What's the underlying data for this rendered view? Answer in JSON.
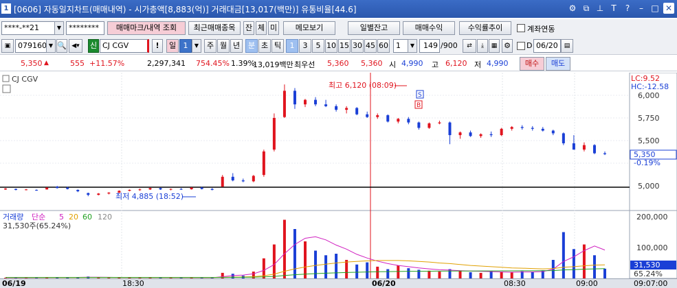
{
  "window": {
    "number": "1",
    "title": "[0606] 자동일지차트(매매내역) - 시가총액[8,883(억)] 거래대금[13,017(백만)] 유통비율[44.6]",
    "icons": [
      "settings-icon",
      "restore-icon",
      "pin-icon",
      "font-icon",
      "help-icon",
      "minimize-icon",
      "maximize-icon",
      "close-icon"
    ],
    "icon_glyphs": [
      "⚙",
      "⧉",
      "⊥",
      "T",
      "?",
      "–",
      "□",
      "✕"
    ]
  },
  "toolbar1": {
    "account": "****-**21",
    "password": "********",
    "trade_mark_btn": "매매마크/내역 조회",
    "recent_btn": "최근매매종목",
    "jan_btn": "잔",
    "che_btn": "체",
    "mi_btn": "미",
    "memo_btn": "메모보기",
    "daily_btn": "일별잔고",
    "profit_btn": "매매수익",
    "yield_btn": "수익률추이",
    "account_link_label": "계좌연동"
  },
  "toolbar2": {
    "code": "079160",
    "shin": "신",
    "stock_name": "CJ CGV",
    "excl": "!",
    "il": "일",
    "il_num": "1",
    "periods": [
      "주",
      "월",
      "년",
      "분",
      "초",
      "틱"
    ],
    "active_period": "분",
    "intervals": [
      "1",
      "3",
      "5",
      "10",
      "15",
      "30",
      "45",
      "60"
    ],
    "active_interval": "1",
    "count_sel": "1",
    "count_value": "149",
    "count_total": "/900",
    "d_label": "D",
    "date": "06/20"
  },
  "quote": {
    "price": "5,350",
    "change": "555",
    "change_pct": "+11.57%",
    "volume": "2,297,341",
    "vol_ratio": "754.45%",
    "turnover": "1.39%",
    "amount": "13,019백만",
    "best_label": "최우선",
    "ask": "5,360",
    "bid": "5,360",
    "open_label": "시",
    "open": "4,990",
    "high_label": "고",
    "high": "6,120",
    "low_label": "저",
    "low": "4,990",
    "buy_btn": "매수",
    "sell_btn": "매도"
  },
  "price_panel": {
    "name": "CJ CGV",
    "lc": "LC:9.52",
    "hc": "HC:-12.58",
    "high_anno": "최고 6,120 (08:09)",
    "low_anno": "최저 4,885 (18:52)",
    "cur_price": "5,350",
    "cur_pct": "-0.19%",
    "sell_marker": "S",
    "buy_marker": "B",
    "y_labels": [
      "6,000",
      "5,750",
      "5,500",
      "5,000"
    ]
  },
  "volume_panel": {
    "legend": {
      "vol": "거래량",
      "simple": "단순",
      "ma5": "5",
      "ma20": "20",
      "ma60": "60",
      "ma120": "120"
    },
    "summary": "31,530주(65.24%)",
    "cur_vol": "31,530",
    "cur_pct": "65.24%",
    "y_labels": [
      "200,000",
      "100,000"
    ]
  },
  "x_axis": [
    "06/19",
    "18:30",
    "06/20",
    "08:30",
    "09:00",
    "09:07:00"
  ],
  "colors": {
    "up": "#e0141e",
    "down": "#1a3fd6",
    "ma5": "#d020c0",
    "ma20": "#e0a000",
    "ma60": "#20a020",
    "ma120": "#888888"
  },
  "chart_data": {
    "type": "candlestick",
    "title": "CJ CGV",
    "ohlc": [
      [
        4960,
        4975,
        4955,
        4970
      ],
      [
        4965,
        4970,
        4950,
        4955
      ],
      [
        4958,
        4965,
        4950,
        4960
      ],
      [
        4955,
        4960,
        4945,
        4950
      ],
      [
        4960,
        4985,
        4958,
        4980
      ],
      [
        4990,
        5000,
        4970,
        4975
      ],
      [
        4980,
        4990,
        4960,
        4965
      ],
      [
        4955,
        4960,
        4930,
        4940
      ],
      [
        4920,
        4925,
        4885,
        4900
      ],
      [
        4900,
        4920,
        4895,
        4915
      ],
      [
        4915,
        4930,
        4905,
        4925
      ],
      [
        4925,
        4950,
        4920,
        4945
      ],
      [
        4945,
        4960,
        4940,
        4955
      ],
      [
        4955,
        4970,
        4945,
        4960
      ],
      [
        4960,
        4980,
        4955,
        4975
      ],
      [
        4975,
        4980,
        4955,
        4960
      ],
      [
        4960,
        4970,
        4950,
        4965
      ],
      [
        4965,
        4975,
        4955,
        4960
      ],
      [
        4962,
        4985,
        4958,
        4980
      ],
      [
        4980,
        4990,
        4960,
        4965
      ],
      [
        4965,
        4975,
        4950,
        4955
      ],
      [
        4990,
        5120,
        4990,
        5100
      ],
      [
        5100,
        5140,
        5050,
        5060
      ],
      [
        5060,
        5080,
        5040,
        5050
      ],
      [
        5050,
        5120,
        5040,
        5110
      ],
      [
        5120,
        5400,
        5100,
        5380
      ],
      [
        5400,
        5800,
        5380,
        5750
      ],
      [
        5760,
        6120,
        5750,
        6050
      ],
      [
        6050,
        6080,
        5850,
        5900
      ],
      [
        5900,
        5960,
        5870,
        5950
      ],
      [
        5950,
        5980,
        5880,
        5900
      ],
      [
        5900,
        5950,
        5870,
        5880
      ],
      [
        5880,
        5900,
        5820,
        5840
      ],
      [
        5840,
        5880,
        5800,
        5860
      ],
      [
        5860,
        5870,
        5780,
        5790
      ],
      [
        5790,
        5820,
        5750,
        5760
      ],
      [
        5760,
        5800,
        5740,
        5780
      ],
      [
        5780,
        5790,
        5700,
        5710
      ],
      [
        5710,
        5750,
        5690,
        5740
      ],
      [
        5740,
        5760,
        5680,
        5700
      ],
      [
        5700,
        5710,
        5620,
        5640
      ],
      [
        5640,
        5700,
        5630,
        5690
      ],
      [
        5690,
        5720,
        5680,
        5700
      ],
      [
        5700,
        5710,
        5460,
        5560
      ],
      [
        5560,
        5600,
        5520,
        5590
      ],
      [
        5590,
        5610,
        5540,
        5550
      ],
      [
        5550,
        5580,
        5530,
        5570
      ],
      [
        5570,
        5600,
        5540,
        5560
      ],
      [
        5560,
        5640,
        5550,
        5630
      ],
      [
        5630,
        5660,
        5610,
        5650
      ],
      [
        5650,
        5670,
        5620,
        5640
      ],
      [
        5640,
        5660,
        5610,
        5630
      ],
      [
        5630,
        5650,
        5600,
        5610
      ],
      [
        5610,
        5620,
        5560,
        5580
      ],
      [
        5580,
        5590,
        5450,
        5470
      ],
      [
        5470,
        5560,
        5400,
        5400
      ],
      [
        5400,
        5480,
        5380,
        5450
      ],
      [
        5450,
        5460,
        5350,
        5360
      ],
      [
        5360,
        5380,
        5340,
        5350
      ]
    ],
    "volume": [
      2000,
      1500,
      1800,
      1200,
      3000,
      4000,
      2500,
      3500,
      6000,
      2000,
      1800,
      2200,
      2500,
      2100,
      3000,
      2400,
      1900,
      2200,
      2600,
      2300,
      2000,
      18000,
      15000,
      9000,
      22000,
      65000,
      110000,
      190000,
      160000,
      120000,
      90000,
      75000,
      80000,
      60000,
      45000,
      52000,
      38000,
      30000,
      42000,
      33000,
      28000,
      25000,
      22000,
      30000,
      26000,
      20000,
      18000,
      24000,
      21000,
      19000,
      23000,
      20000,
      26000,
      60000,
      150000,
      95000,
      110000,
      75000,
      31530
    ],
    "ma5": [
      2100,
      2000,
      2100,
      2200,
      2500,
      3000,
      3200,
      3400,
      4000,
      3800,
      3600,
      3100,
      2900,
      2700,
      2800,
      2600,
      2500,
      2400,
      2400,
      2300,
      2200,
      5500,
      9000,
      11000,
      15000,
      26000,
      45000,
      80000,
      110000,
      130000,
      135000,
      125000,
      108000,
      95000,
      78000,
      66000,
      56000,
      48000,
      42000,
      38000,
      34000,
      31000,
      28000,
      27000,
      25000,
      24000,
      23000,
      22000,
      21000,
      20000,
      21000,
      21000,
      22000,
      30000,
      55000,
      70000,
      90000,
      105000,
      92000
    ],
    "ma20": [
      2800,
      2800,
      2700,
      2700,
      2700,
      2800,
      2800,
      2900,
      3000,
      3000,
      3000,
      2900,
      2900,
      2900,
      2900,
      2900,
      2800,
      2800,
      2800,
      2800,
      2800,
      3600,
      4200,
      4600,
      5600,
      8700,
      14000,
      23000,
      31000,
      37000,
      42000,
      46000,
      50000,
      53000,
      55000,
      57000,
      58000,
      58000,
      58000,
      57000,
      55000,
      53000,
      50000,
      48000,
      45000,
      42000,
      40000,
      38000,
      36000,
      34000,
      33000,
      32000,
      31000,
      32000,
      36000,
      38000,
      41000,
      43000,
      44000
    ],
    "ma60": [
      3000,
      3000,
      3000,
      3000,
      3000,
      3000,
      3000,
      3000,
      3000,
      3000,
      3000,
      3000,
      3000,
      3000,
      3000,
      3000,
      3000,
      3000,
      3000,
      3000,
      3000,
      3200,
      3400,
      3600,
      3900,
      4900,
      6500,
      9500,
      12000,
      14000,
      15500,
      17000,
      18000,
      19000,
      20000,
      21000,
      21500,
      22000,
      22500,
      23000,
      23200,
      23400,
      23600,
      23800,
      24000,
      24100,
      24200,
      24300,
      24400,
      24500,
      24600,
      24700,
      24800,
      25400,
      27500,
      28500,
      30000,
      31000,
      31500
    ]
  }
}
